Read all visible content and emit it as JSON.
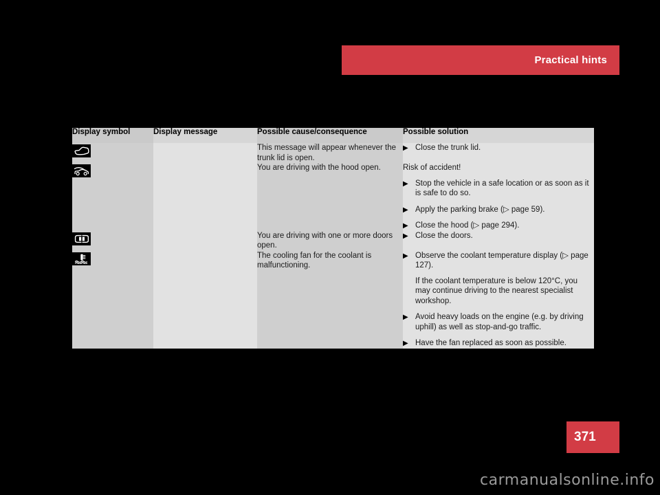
{
  "header": {
    "title": "Practical hints",
    "accent_color": "#d23c45"
  },
  "page_number": "371",
  "watermark": "carmanualsonline.info",
  "table": {
    "columns": [
      "Display symbol",
      "Display message",
      "Possible cause/consequence",
      "Possible solution"
    ],
    "rows": [
      {
        "symbol_icon": "car-trunk-open-icon",
        "message": "",
        "cause": "This message will appear whenever the trunk lid is open.",
        "solution_lead": "",
        "solution_items": [
          {
            "text": "Close the trunk lid."
          }
        ]
      },
      {
        "symbol_icon": "car-hood-open-icon",
        "message": "",
        "cause": "You are driving with the hood open.",
        "solution_lead": "Risk of accident!",
        "solution_items": [
          {
            "text": "Stop the vehicle in a safe location or as soon as it is safe to do so."
          },
          {
            "text": "Apply the parking brake (▷ page 59)."
          },
          {
            "text": "Close the hood (▷ page 294)."
          }
        ]
      },
      {
        "symbol_icon": "car-doors-open-icon",
        "message": "",
        "cause": "You are driving with one or more doors open.",
        "solution_lead": "",
        "solution_items": [
          {
            "text": "Close the doors."
          }
        ]
      },
      {
        "symbol_icon": "coolant-temperature-icon",
        "message": "",
        "cause": "The cooling fan for the coolant is malfunctioning.",
        "solution_lead": "",
        "solution_items": [
          {
            "text": "Observe the coolant temperature display (▷ page 127).",
            "note": "If the coolant temperature is below 120°C, you may continue driving to the nearest specialist workshop."
          },
          {
            "text": "Avoid heavy loads on the engine (e.g. by driving uphill) as well as stop-and-go traffic."
          },
          {
            "text": "Have the fan replaced as soon as possible."
          }
        ]
      }
    ]
  },
  "bullet_glyph": "▶"
}
